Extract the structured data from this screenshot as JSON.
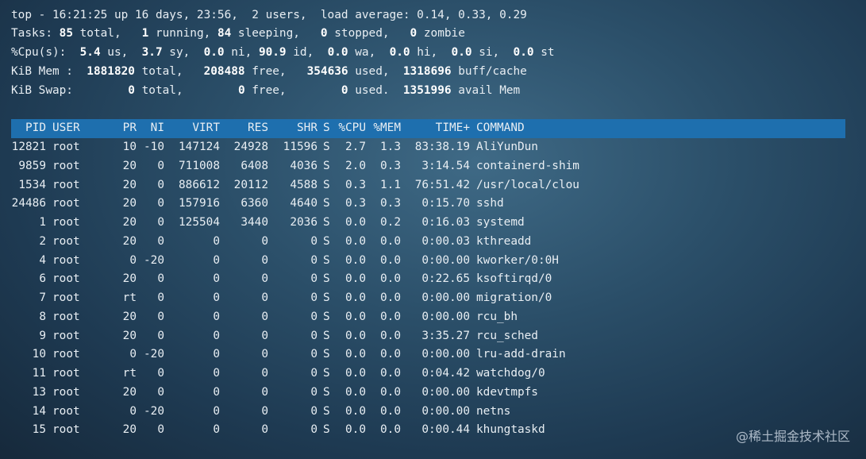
{
  "summary": {
    "top_line": {
      "prefix": "top - ",
      "time": "16:21:25",
      "uptime": " up 16 days, 23:56,  2 users,  load average: 0.14, 0.33, 0.29"
    },
    "tasks": {
      "label": "Tasks: ",
      "total": "85",
      "total_l": " total,   ",
      "running": "1",
      "running_l": " running, ",
      "sleeping": "84",
      "sleeping_l": " sleeping,   ",
      "stopped": "0",
      "stopped_l": " stopped,   ",
      "zombie": "0",
      "zombie_l": " zombie"
    },
    "cpu": {
      "label": "%Cpu(s):  ",
      "us": "5.4",
      "us_l": " us,  ",
      "sy": "3.7",
      "sy_l": " sy,  ",
      "ni": "0.0",
      "ni_l": " ni, ",
      "id": "90.9",
      "id_l": " id,  ",
      "wa": "0.0",
      "wa_l": " wa,  ",
      "hi": "0.0",
      "hi_l": " hi,  ",
      "si": "0.0",
      "si_l": " si,  ",
      "st": "0.0",
      "st_l": " st"
    },
    "mem": {
      "label": "KiB Mem : ",
      "total": " 1881820",
      "total_l": " total,  ",
      "free": " 208488",
      "free_l": " free,   ",
      "used": "354636",
      "used_l": " used,  ",
      "buff": "1318696",
      "buff_l": " buff/cache"
    },
    "swap": {
      "label": "KiB Swap:        ",
      "total": "0",
      "total_l": " total,        ",
      "free": "0",
      "free_l": " free,        ",
      "used": "0",
      "used_l": " used.  ",
      "avail": "1351996",
      "avail_l": " avail Mem"
    }
  },
  "columns": [
    "PID",
    "USER",
    "PR",
    "NI",
    "VIRT",
    "RES",
    "SHR",
    "S",
    "%CPU",
    "%MEM",
    "TIME+",
    "COMMAND"
  ],
  "processes": [
    [
      "12821",
      "root",
      "10",
      "-10",
      "147124",
      "24928",
      "11596",
      "S",
      "2.7",
      "1.3",
      "83:38.19",
      "AliYunDun"
    ],
    [
      "9859",
      "root",
      "20",
      "0",
      "711008",
      "6408",
      "4036",
      "S",
      "2.0",
      "0.3",
      "3:14.54",
      "containerd-shim"
    ],
    [
      "1534",
      "root",
      "20",
      "0",
      "886612",
      "20112",
      "4588",
      "S",
      "0.3",
      "1.1",
      "76:51.42",
      "/usr/local/clou"
    ],
    [
      "24486",
      "root",
      "20",
      "0",
      "157916",
      "6360",
      "4640",
      "S",
      "0.3",
      "0.3",
      "0:15.70",
      "sshd"
    ],
    [
      "1",
      "root",
      "20",
      "0",
      "125504",
      "3440",
      "2036",
      "S",
      "0.0",
      "0.2",
      "0:16.03",
      "systemd"
    ],
    [
      "2",
      "root",
      "20",
      "0",
      "0",
      "0",
      "0",
      "S",
      "0.0",
      "0.0",
      "0:00.03",
      "kthreadd"
    ],
    [
      "4",
      "root",
      "0",
      "-20",
      "0",
      "0",
      "0",
      "S",
      "0.0",
      "0.0",
      "0:00.00",
      "kworker/0:0H"
    ],
    [
      "6",
      "root",
      "20",
      "0",
      "0",
      "0",
      "0",
      "S",
      "0.0",
      "0.0",
      "0:22.65",
      "ksoftirqd/0"
    ],
    [
      "7",
      "root",
      "rt",
      "0",
      "0",
      "0",
      "0",
      "S",
      "0.0",
      "0.0",
      "0:00.00",
      "migration/0"
    ],
    [
      "8",
      "root",
      "20",
      "0",
      "0",
      "0",
      "0",
      "S",
      "0.0",
      "0.0",
      "0:00.00",
      "rcu_bh"
    ],
    [
      "9",
      "root",
      "20",
      "0",
      "0",
      "0",
      "0",
      "S",
      "0.0",
      "0.0",
      "3:35.27",
      "rcu_sched"
    ],
    [
      "10",
      "root",
      "0",
      "-20",
      "0",
      "0",
      "0",
      "S",
      "0.0",
      "0.0",
      "0:00.00",
      "lru-add-drain"
    ],
    [
      "11",
      "root",
      "rt",
      "0",
      "0",
      "0",
      "0",
      "S",
      "0.0",
      "0.0",
      "0:04.42",
      "watchdog/0"
    ],
    [
      "13",
      "root",
      "20",
      "0",
      "0",
      "0",
      "0",
      "S",
      "0.0",
      "0.0",
      "0:00.00",
      "kdevtmpfs"
    ],
    [
      "14",
      "root",
      "0",
      "-20",
      "0",
      "0",
      "0",
      "S",
      "0.0",
      "0.0",
      "0:00.00",
      "netns"
    ],
    [
      "15",
      "root",
      "20",
      "0",
      "0",
      "0",
      "0",
      "S",
      "0.0",
      "0.0",
      "0:00.44",
      "khungtaskd"
    ]
  ],
  "watermark": "@稀土掘金技术社区"
}
